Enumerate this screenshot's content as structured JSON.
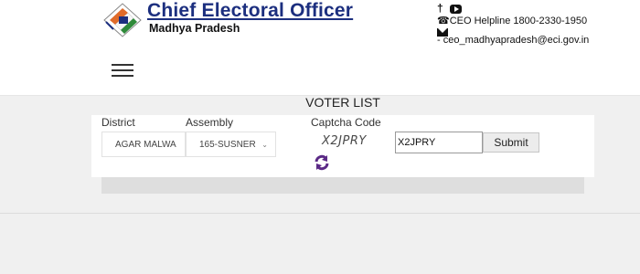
{
  "header": {
    "title": "Chief Electoral Officer",
    "subtitle": "Madhya Pradesh",
    "helpline": "CEO Helpline 1800-2330-1950",
    "email": "- ceo_madhyapradesh@eci.gov.in"
  },
  "page": {
    "title": "VOTER LIST"
  },
  "form": {
    "district_label": "District",
    "district_value": "AGAR MALWA",
    "assembly_label": "Assembly",
    "assembly_value": "165-SUSNER",
    "captcha_label": "Captcha Code",
    "captcha_text": "X2JPRY",
    "captcha_input_value": "X2JPRY",
    "submit_label": "Submit"
  },
  "colors": {
    "brand": "#1c2f7f",
    "refresh_icon": "#5b2a86"
  }
}
